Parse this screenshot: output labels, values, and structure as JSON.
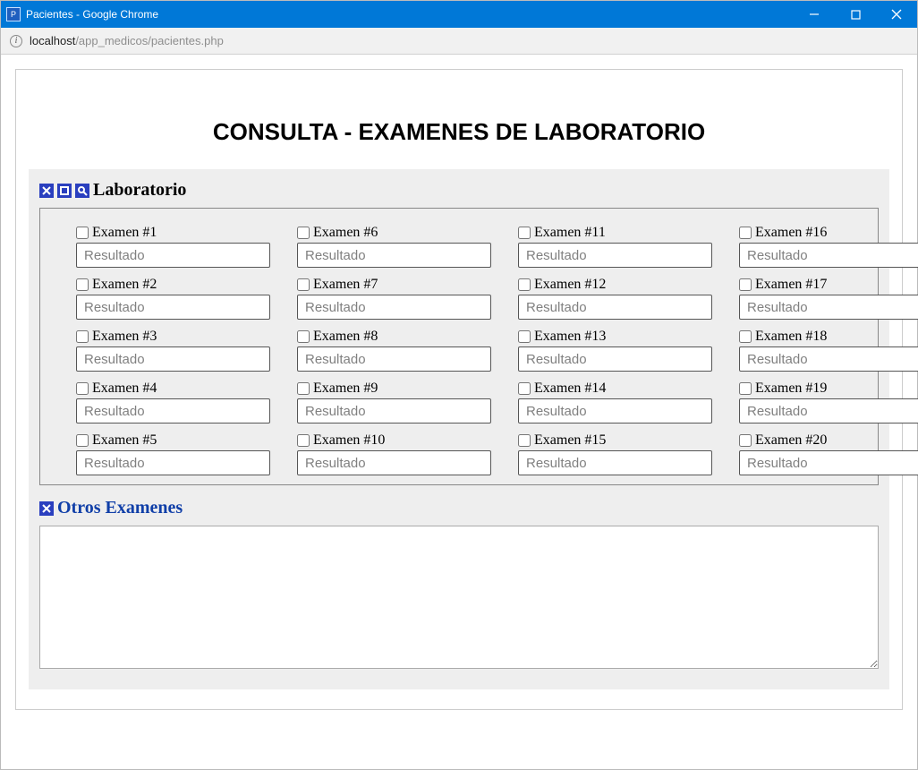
{
  "window": {
    "title": "Pacientes - Google Chrome"
  },
  "address": {
    "host": "localhost",
    "path": "/app_medicos/pacientes.php"
  },
  "page": {
    "heading": "CONSULTA - EXAMENES DE LABORATORIO"
  },
  "laboratorio": {
    "legend": "Laboratorio",
    "result_placeholder": "Resultado",
    "columns": [
      [
        {
          "label": "Examen #1"
        },
        {
          "label": "Examen #2"
        },
        {
          "label": "Examen #3"
        },
        {
          "label": "Examen #4"
        },
        {
          "label": "Examen #5"
        }
      ],
      [
        {
          "label": "Examen #6"
        },
        {
          "label": "Examen #7"
        },
        {
          "label": "Examen #8"
        },
        {
          "label": "Examen #9"
        },
        {
          "label": "Examen #10"
        }
      ],
      [
        {
          "label": "Examen #11"
        },
        {
          "label": "Examen #12"
        },
        {
          "label": "Examen #13"
        },
        {
          "label": "Examen #14"
        },
        {
          "label": "Examen #15"
        }
      ],
      [
        {
          "label": "Examen #16"
        },
        {
          "label": "Examen #17"
        },
        {
          "label": "Examen #18"
        },
        {
          "label": "Examen #19"
        },
        {
          "label": "Examen #20"
        }
      ]
    ]
  },
  "otros": {
    "legend": "Otros Examenes",
    "value": ""
  }
}
